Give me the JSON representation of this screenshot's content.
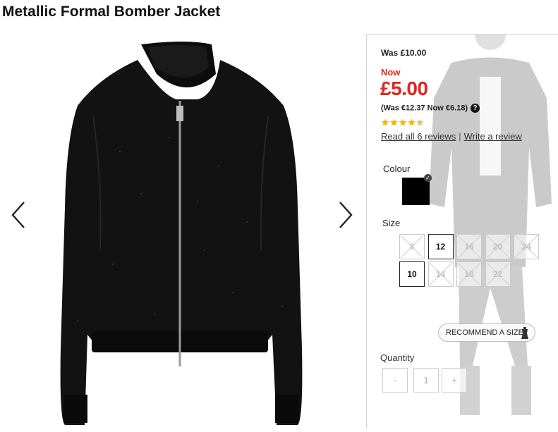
{
  "product": {
    "title": "Metallic Formal Bomber Jacket"
  },
  "price": {
    "was": "Was £10.00",
    "now_label": "Now",
    "now": "£5.00",
    "euro": "(Was €12.37 Now €6.18)",
    "help_icon": "?"
  },
  "rating": {
    "value": 4.5,
    "out_of": 5,
    "icon": "star-icon"
  },
  "reviews": {
    "read_link": "Read all 6 reviews",
    "separator": "|",
    "write_link": "Write a review"
  },
  "colour": {
    "label": "Colour",
    "selected": "Black",
    "swatch_color": "#000000"
  },
  "size": {
    "label": "Size",
    "row1": [
      {
        "label": "8",
        "available": false
      },
      {
        "label": "12",
        "available": true
      },
      {
        "label": "16",
        "available": false
      },
      {
        "label": "20",
        "available": false
      },
      {
        "label": "24",
        "available": false
      }
    ],
    "row2": [
      {
        "label": "10",
        "available": true
      },
      {
        "label": "14",
        "available": false
      },
      {
        "label": "18",
        "available": false
      },
      {
        "label": "22",
        "available": false
      }
    ]
  },
  "recommend": {
    "label": "RECOMMEND A SIZE"
  },
  "quantity": {
    "label": "Quantity",
    "minus": "-",
    "value": "1",
    "plus": "+"
  },
  "colors": {
    "sale_red": "#e1261c",
    "star": "#f5b800"
  }
}
